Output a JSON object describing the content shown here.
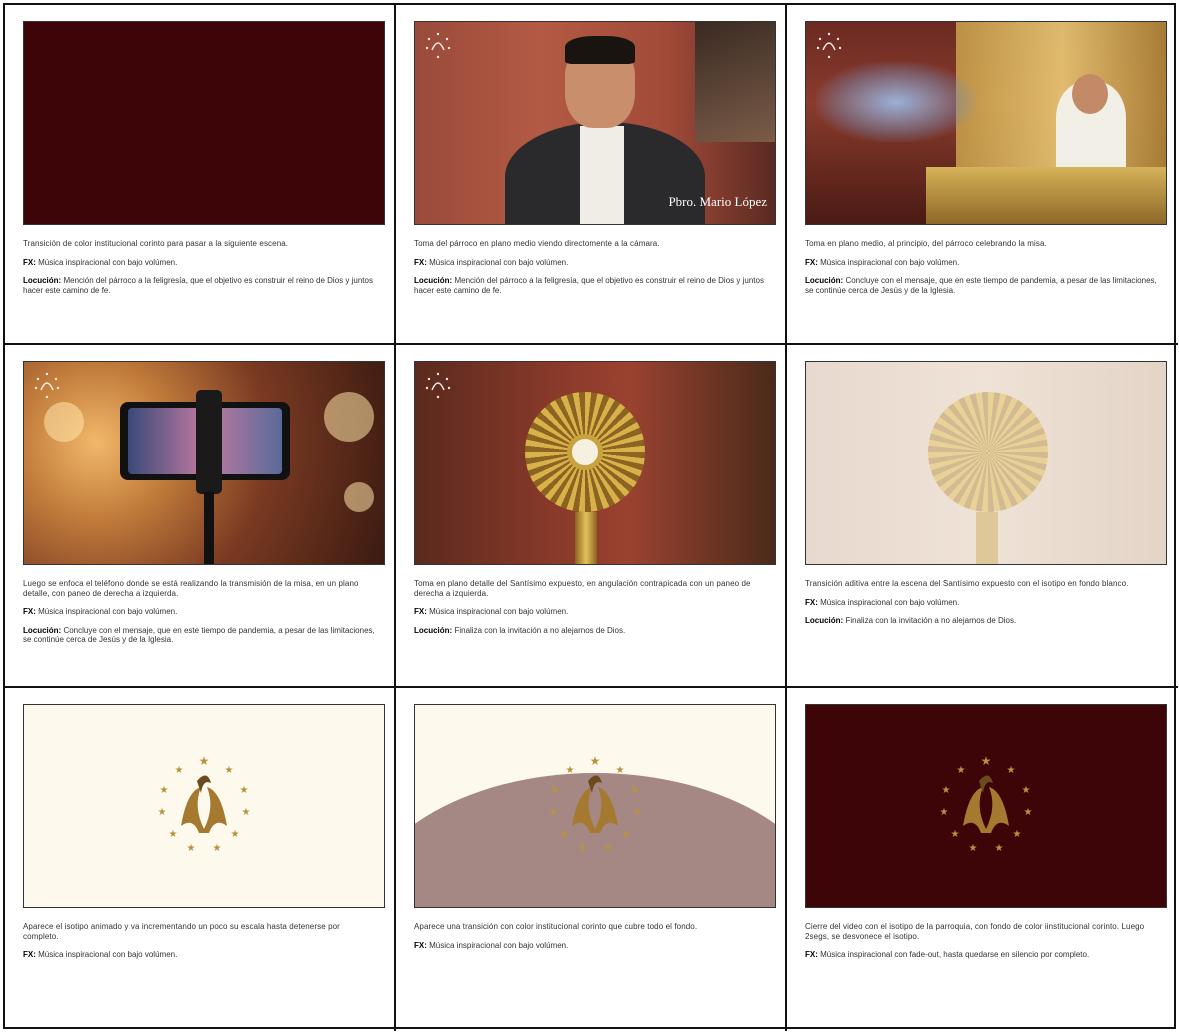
{
  "colors": {
    "maroon": "#3d0508",
    "cream": "#fdf9ec",
    "rose": "#a58784",
    "gold": "#c9a240"
  },
  "cells": [
    {
      "frame": "maroon-solid",
      "description": "Transición de color institucional corinto para pasar a la siguiente escena.",
      "fx_label": "FX:",
      "fx": "Música inspiracional con bajo volúmen.",
      "locucion_label": "Locución:",
      "locucion": "Mención del párroco a la feligresía, que el objetivo es construir el reino de Dios y juntos hacer este camino de fe."
    },
    {
      "frame": "priest-interview",
      "caption": "Pbro. Mario López",
      "description": "Toma del párroco en plano medio viendo directomente a la cámara.",
      "fx_label": "FX:",
      "fx": "Música inspiracional con bajo volúmen.",
      "locucion_label": "Locución:",
      "locucion": "Mención del párroco a la feligresía, que el objetivo es construir el reino de Dios y juntos hacer este camino de fe."
    },
    {
      "frame": "priest-altar",
      "description": "Toma en plano medio, al principio, del párroco celebrando la misa.",
      "fx_label": "FX:",
      "fx": "Música inspiracional con bajo volúmen.",
      "locucion_label": "Locución:",
      "locucion": "Concluye con el mensaje, que en este tiempo de pandemia, a pesar de las limitaciones, se continúe cerca de Jesús y de la Iglesia."
    },
    {
      "frame": "phone-stream",
      "description": "Luego se enfoca el teléfono donde se está realizando la transmisión de la misa, en un plano detalle, con paneo de derecha a izquierda.",
      "fx_label": "FX:",
      "fx": "Música inspiracional con bajo volúmen.",
      "locucion_label": "Locución:",
      "locucion": "Concluye con el mensaje, que en este tiempo de pandemia, a pesar de las limitaciones, se continúe cerca de Jesús y de la Iglesia."
    },
    {
      "frame": "monstrance",
      "description": "Toma en plano detalle del Santísimo expuesto, en angulación contrapica­da con un paneo de derecha a izquierda.",
      "fx_label": "FX:",
      "fx": "Música inspiracional con bajo volúmen.",
      "locucion_label": "Locución:",
      "locucion": "Finaliza con la invitación a no alejarnos de Dios."
    },
    {
      "frame": "monstrance-fade",
      "description": "Transición aditiva entre la escena del Santísimo expuesto con el isotipo en fondo blanco.",
      "fx_label": "FX:",
      "fx": "Música inspiracional con bajo volúmen.",
      "locucion_label": "Locución:",
      "locucion": "Finaliza con la invitación a no alejarnos de Dios."
    },
    {
      "frame": "logo-cream",
      "description": "Aparece el isotipo animado y va incrementando un poco su escala hasta detenerse por completo.",
      "fx_label": "FX:",
      "fx": "Música inspiracional con bajo volúmen."
    },
    {
      "frame": "logo-wipe",
      "description": "Aparece una transición con color institucional corinto que cubre todo el fondo.",
      "fx_label": "FX:",
      "fx": "Música inspiracional con bajo volúmen."
    },
    {
      "frame": "logo-maroon",
      "description": "Cierre del video con el isotipo de la parroquia, con fondo de color iinstitucional corinto. Luego 2segs, se desvonece el isotipo.",
      "fx_label": "FX:",
      "fx": "Música inspiracional con fade-out, hasta quedarse en silencio por completo."
    }
  ]
}
